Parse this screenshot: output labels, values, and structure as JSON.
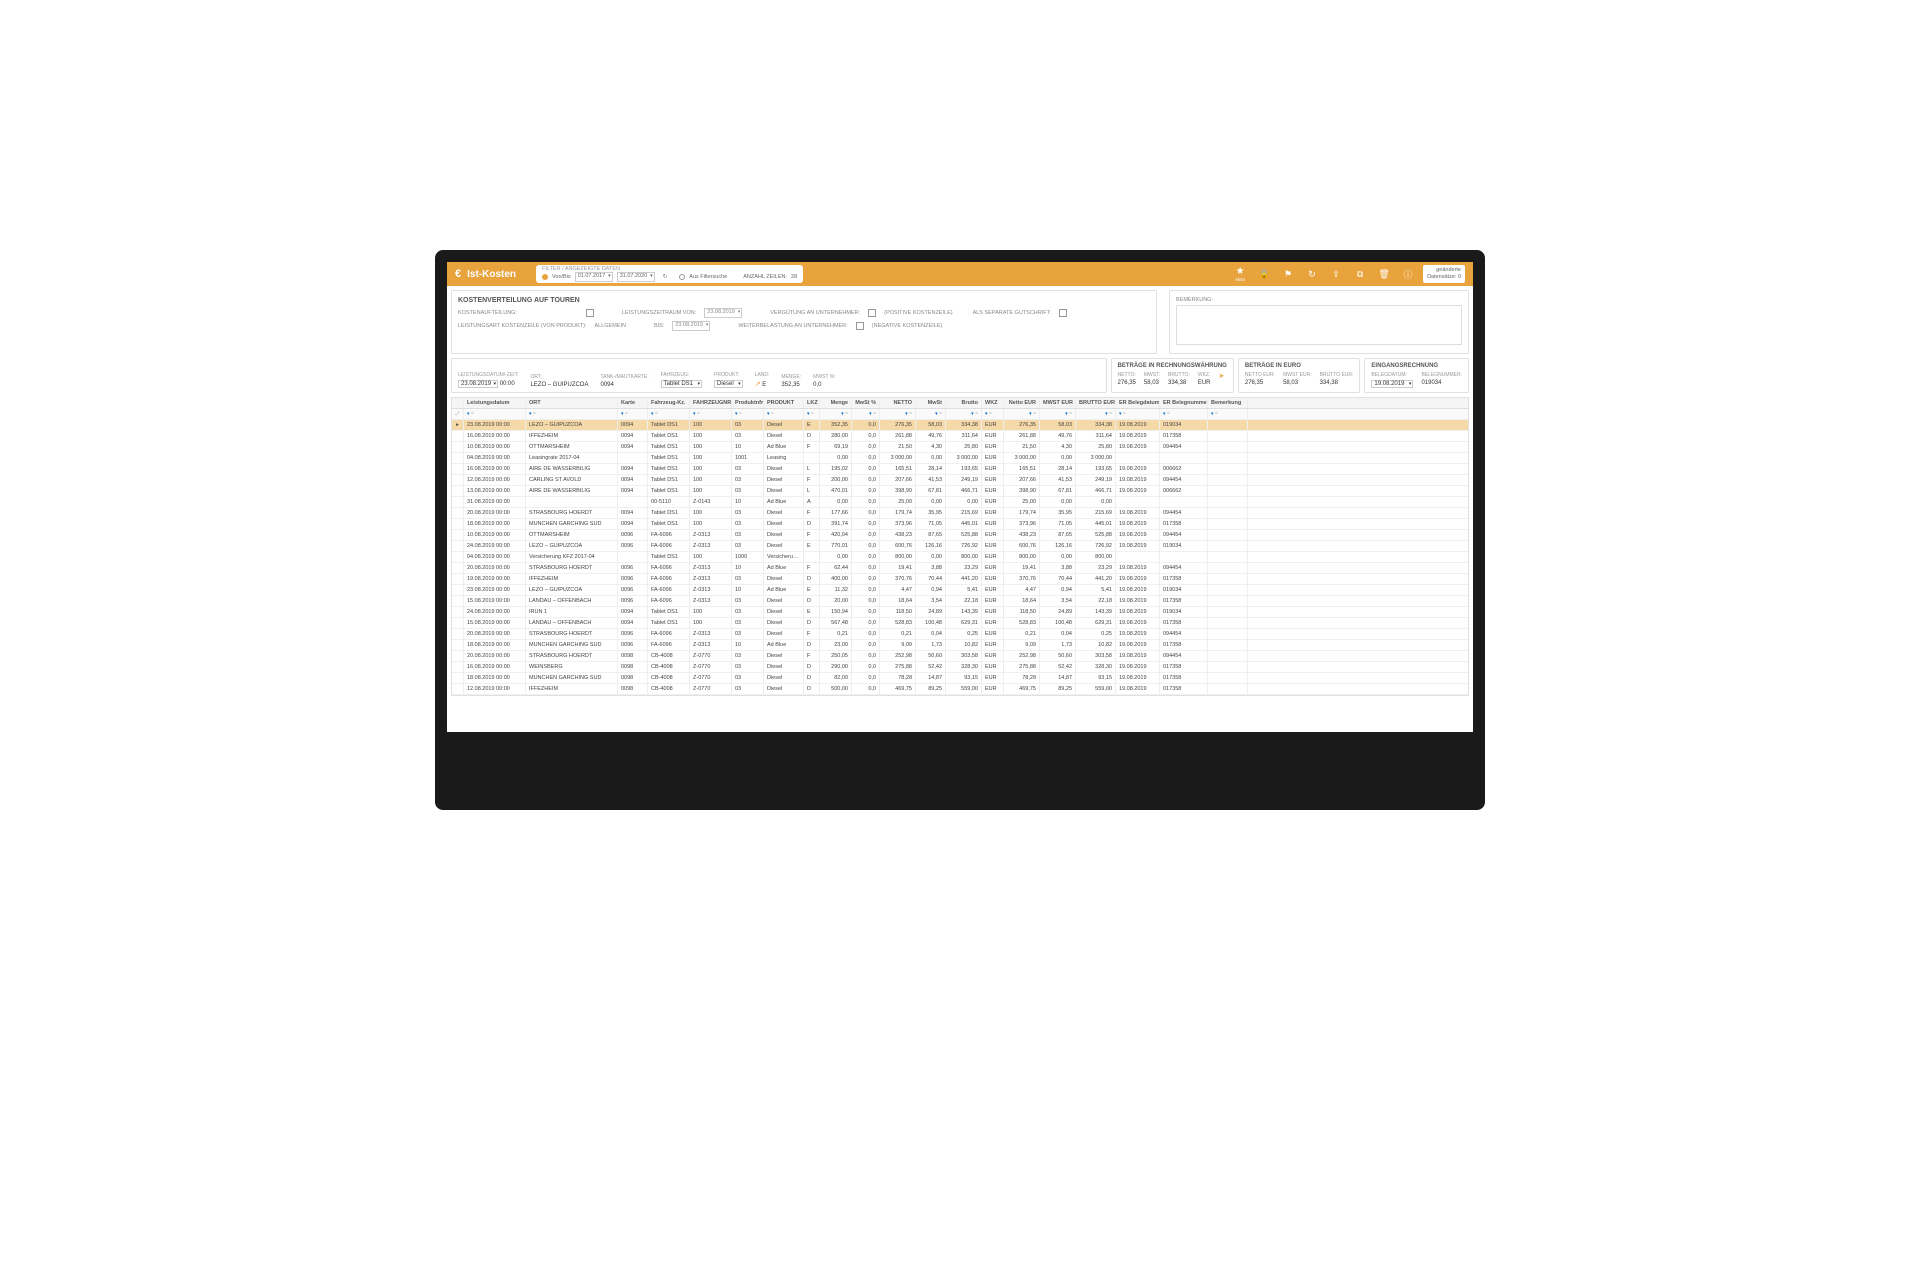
{
  "app": {
    "title": "Ist-Kosten"
  },
  "status": {
    "line1": "geänderte",
    "line2": "Datensätze: 0"
  },
  "toolbar": {
    "star_label": "Aktiv"
  },
  "filter": {
    "header": "FILTER / ANGEZEIGTE DATEN",
    "vonbis": "Von/Bis",
    "from": "01.07.2017",
    "to": "31.07.2020",
    "aus_filter": "Aus Filtersuche",
    "anzahl": "ANZAHL ZEILEN:",
    "anzahl_val": "28"
  },
  "panel": {
    "title": "KOSTENVERTEILUNG AUF TOUREN",
    "row1_l1": "KOSTENAUFTEILUNG:",
    "row1_l2": "LEISTUNGSZEITRAUM VON:",
    "row1_v2": "23.08.2019",
    "row1_l3": "VERGÜTUNG AN UNTERNEHMER:",
    "row1_l4": "(POSITIVE KOSTENZEILE)",
    "row1_l5": "ALS SEPARATE GUTSCHRIFT:",
    "row2_l1": "LEISTUNGSART KOSTENZEILE (VON PRODUKT):",
    "row2_v1": "ALLGEMEIN",
    "row2_l2": "BIS:",
    "row2_v2": "23.08.2019",
    "row2_l3": "WEITERBELASTUNG AN UNTERNEHMER:",
    "row2_l4": "(NEGATIVE KOSTENZEILE)",
    "remark": "BEMERKUNG:"
  },
  "detail": {
    "main": {
      "c1l": "LEISTUNGSDATUM/-ZEIT:",
      "c1v1": "23.08.2019",
      "c1v2": "00:00",
      "c2l": "ORT:",
      "c2v": "LEZO – GUIPUZCOA",
      "c3l": "TANK-/MAUTKARTE:",
      "c3v": "0094",
      "c4l": "FAHRZEUG:",
      "c4v": "Tablet DS1",
      "c5l": "PRODUKT:",
      "c5v": "Diesel",
      "c6l": "LAND:",
      "c6v": "E",
      "c7l": "MENGE:",
      "c7v": "352,35",
      "c8l": "MWST %:",
      "c8v": "0,0"
    },
    "box1": {
      "title": "BETRÄGE IN RECHNUNGSWÄHRUNG",
      "l1": "NETTO:",
      "v1": "276,35",
      "l2": "MWST:",
      "v2": "58,03",
      "l3": "BRUTTO:",
      "v3": "334,38",
      "l4": "WKZ:",
      "v4": "EUR"
    },
    "box2": {
      "title": "BETRÄGE IN EURO",
      "l1": "NETTO EUR:",
      "v1": "276,35",
      "l2": "MWST EUR:",
      "v2": "58,03",
      "l3": "BRUTTO EUR:",
      "v3": "334,38"
    },
    "box3": {
      "title": "EINGANGSRECHNUNG",
      "l1": "BELEGDATUM:",
      "v1": "19.08.2019",
      "l2": "BELEGNUMMER:",
      "v2": "019034"
    }
  },
  "grid": {
    "cols": [
      "",
      "Leistungsdatum",
      "ORT",
      "Karte",
      "Fahrzeug-Kz.",
      "FAHRZEUGNR",
      "Produktnfr",
      "PRODUKT",
      "LKZ",
      "Menge",
      "MwSt %",
      "NETTO",
      "MwSt",
      "Brutto",
      "WKZ",
      "Netto EUR",
      "MWST EUR",
      "BRUTTO EUR",
      "ER Belegdatum",
      "ER Belegnummer",
      "Bemerkung"
    ],
    "rows": [
      {
        "sel": true,
        "d": [
          "▸",
          "23.08.2019 00:00",
          "LEZO – GUIPUZCOA",
          "0094",
          "Tablet DS1",
          "100",
          "03",
          "Diesel",
          "E",
          "352,35",
          "0,0",
          "276,35",
          "58,03",
          "334,38",
          "EUR",
          "276,35",
          "58,03",
          "334,38",
          "19.08.2019",
          "019034",
          ""
        ]
      },
      {
        "d": [
          "",
          "16.08.2019 00:00",
          "IFFEZHEIM",
          "0094",
          "Tablet DS1",
          "100",
          "03",
          "Diesel",
          "D",
          "280,00",
          "0,0",
          "261,88",
          "49,76",
          "311,64",
          "EUR",
          "261,88",
          "49,76",
          "311,64",
          "19.08.2019",
          "017358",
          ""
        ]
      },
      {
        "d": [
          "",
          "10.08.2019 00:00",
          "OTTMARSHEIM",
          "0094",
          "Tablet DS1",
          "100",
          "10",
          "Ad Blue",
          "F",
          "69,19",
          "0,0",
          "21,50",
          "4,30",
          "25,80",
          "EUR",
          "21,50",
          "4,30",
          "25,80",
          "19.08.2019",
          "094454",
          ""
        ]
      },
      {
        "d": [
          "",
          "04.08.2019 00:00",
          "Leasingrate 2017-04",
          "",
          "Tablet DS1",
          "100",
          "1001",
          "Leasing",
          "",
          "0,00",
          "0,0",
          "3 000,00",
          "0,00",
          "3 000,00",
          "EUR",
          "3 000,00",
          "0,00",
          "3 000,00",
          "",
          "",
          ""
        ]
      },
      {
        "d": [
          "",
          "16.08.2019 00:00",
          "AIRE DE WASSERBILIG",
          "0094",
          "Tablet DS1",
          "100",
          "03",
          "Diesel",
          "L",
          "195,02",
          "0,0",
          "165,51",
          "28,14",
          "193,65",
          "EUR",
          "165,51",
          "28,14",
          "193,65",
          "19.08.2019",
          "006662",
          ""
        ]
      },
      {
        "d": [
          "",
          "12.08.2019 00:00",
          "CARLING ST AVOLD",
          "0094",
          "Tablet DS1",
          "100",
          "03",
          "Diesel",
          "F",
          "200,00",
          "0,0",
          "207,66",
          "41,53",
          "249,19",
          "EUR",
          "207,66",
          "41,53",
          "249,19",
          "19.08.2019",
          "094454",
          ""
        ]
      },
      {
        "d": [
          "",
          "13.08.2019 00:00",
          "AIRE DE WASSERBILIG",
          "0094",
          "Tablet DS1",
          "100",
          "03",
          "Diesel",
          "L",
          "470,01",
          "0,0",
          "398,90",
          "67,81",
          "466,71",
          "EUR",
          "398,90",
          "67,81",
          "466,71",
          "19.08.2019",
          "006662",
          ""
        ]
      },
      {
        "d": [
          "",
          "31.08.2019 00:00",
          "",
          "",
          "00-5110",
          "Z-0143",
          "10",
          "Ad Blue",
          "A",
          "0,00",
          "0,0",
          "25,00",
          "0,00",
          "0,00",
          "EUR",
          "25,00",
          "0,00",
          "0,00",
          "",
          "",
          ""
        ]
      },
      {
        "d": [
          "",
          "20.08.2019 00:00",
          "STRASBOURG HOERDT",
          "0094",
          "Tablet DS1",
          "100",
          "03",
          "Diesel",
          "F",
          "177,66",
          "0,0",
          "179,74",
          "35,95",
          "215,69",
          "EUR",
          "179,74",
          "35,95",
          "215,69",
          "19.08.2019",
          "094454",
          ""
        ]
      },
      {
        "d": [
          "",
          "18.08.2019 00:00",
          "MUNCHEN GARCHING SUD",
          "0094",
          "Tablet DS1",
          "100",
          "03",
          "Diesel",
          "D",
          "391,74",
          "0,0",
          "373,96",
          "71,05",
          "445,01",
          "EUR",
          "373,96",
          "71,05",
          "445,01",
          "19.08.2019",
          "017358",
          ""
        ]
      },
      {
        "d": [
          "",
          "10.08.2019 00:00",
          "OTTMARSHEIM",
          "0096",
          "FA-6096",
          "Z-0313",
          "03",
          "Diesel",
          "F",
          "420,04",
          "0,0",
          "438,23",
          "87,65",
          "525,88",
          "EUR",
          "438,23",
          "87,65",
          "525,88",
          "19.08.2019",
          "094454",
          ""
        ]
      },
      {
        "d": [
          "",
          "24.08.2019 00:00",
          "LEZO – GUIPUZCOA",
          "0096",
          "FA-6096",
          "Z-0313",
          "03",
          "Diesel",
          "E",
          "770,01",
          "0,0",
          "600,76",
          "126,16",
          "726,92",
          "EUR",
          "600,76",
          "126,16",
          "726,92",
          "19.08.2019",
          "019034",
          ""
        ]
      },
      {
        "d": [
          "",
          "04.08.2019 00:00",
          "Versicherung KFZ 2017-04",
          "",
          "Tablet DS1",
          "100",
          "1000",
          "Versicheru…",
          "",
          "0,00",
          "0,0",
          "800,00",
          "0,00",
          "800,00",
          "EUR",
          "800,00",
          "0,00",
          "800,00",
          "",
          "",
          ""
        ]
      },
      {
        "d": [
          "",
          "20.08.2019 00:00",
          "STRASBOURG HOERDT",
          "0096",
          "FA-6096",
          "Z-0313",
          "10",
          "Ad Blue",
          "F",
          "62,44",
          "0,0",
          "19,41",
          "3,88",
          "23,29",
          "EUR",
          "19,41",
          "3,88",
          "23,29",
          "19.08.2019",
          "094454",
          ""
        ]
      },
      {
        "d": [
          "",
          "19.08.2019 00:00",
          "IFFEZHEIM",
          "0096",
          "FA-6096",
          "Z-0313",
          "03",
          "Diesel",
          "D",
          "400,00",
          "0,0",
          "370,76",
          "70,44",
          "441,20",
          "EUR",
          "370,76",
          "70,44",
          "441,20",
          "19.08.2019",
          "017358",
          ""
        ]
      },
      {
        "d": [
          "",
          "23.08.2019 00:00",
          "LEZO – GUIPUZCOA",
          "0096",
          "FA-6096",
          "Z-0313",
          "10",
          "Ad Blue",
          "E",
          "11,32",
          "0,0",
          "4,47",
          "0,94",
          "5,41",
          "EUR",
          "4,47",
          "0,94",
          "5,41",
          "19.08.2019",
          "019034",
          ""
        ]
      },
      {
        "d": [
          "",
          "15.08.2019 00:00",
          "LANDAU – OFFENBACH",
          "0096",
          "FA-6096",
          "Z-0313",
          "03",
          "Diesel",
          "D",
          "20,00",
          "0,0",
          "18,64",
          "3,54",
          "22,18",
          "EUR",
          "18,64",
          "3,54",
          "22,18",
          "19.08.2019",
          "017358",
          ""
        ]
      },
      {
        "d": [
          "",
          "24.08.2019 00:00",
          "IRUN 1",
          "0094",
          "Tablet DS1",
          "100",
          "03",
          "Diesel",
          "E",
          "150,94",
          "0,0",
          "118,50",
          "24,89",
          "143,39",
          "EUR",
          "118,50",
          "24,89",
          "143,39",
          "19.08.2019",
          "019034",
          ""
        ]
      },
      {
        "d": [
          "",
          "15.08.2019 00:00",
          "LANDAU – OFFENBACH",
          "0094",
          "Tablet DS1",
          "100",
          "03",
          "Diesel",
          "D",
          "567,48",
          "0,0",
          "528,83",
          "100,48",
          "629,31",
          "EUR",
          "528,83",
          "100,48",
          "629,31",
          "19.08.2019",
          "017358",
          ""
        ]
      },
      {
        "d": [
          "",
          "20.08.2019 00:00",
          "STRASBOURG HOERDT",
          "0096",
          "FA-6096",
          "Z-0313",
          "03",
          "Diesel",
          "F",
          "0,21",
          "0,0",
          "0,21",
          "0,04",
          "0,25",
          "EUR",
          "0,21",
          "0,04",
          "0,25",
          "19.08.2019",
          "094454",
          ""
        ]
      },
      {
        "d": [
          "",
          "18.08.2019 00:00",
          "MUNCHEN GARCHING SUD",
          "0096",
          "FA-6096",
          "Z-0313",
          "10",
          "Ad Blue",
          "D",
          "23,00",
          "0,0",
          "9,09",
          "1,73",
          "10,82",
          "EUR",
          "9,09",
          "1,73",
          "10,82",
          "19.08.2019",
          "017358",
          ""
        ]
      },
      {
        "d": [
          "",
          "20.08.2019 00:00",
          "STRASBOURG HOERDT",
          "0098",
          "CB-4008",
          "Z-0770",
          "03",
          "Diesel",
          "F",
          "250,05",
          "0,0",
          "252,98",
          "50,60",
          "303,58",
          "EUR",
          "252,98",
          "50,60",
          "303,58",
          "19.08.2019",
          "094454",
          ""
        ]
      },
      {
        "d": [
          "",
          "16.08.2019 00:00",
          "WEINSBERG",
          "0098",
          "CB-4008",
          "Z-0770",
          "03",
          "Diesel",
          "D",
          "290,00",
          "0,0",
          "275,88",
          "52,42",
          "328,30",
          "EUR",
          "275,88",
          "52,42",
          "328,30",
          "19.08.2019",
          "017358",
          ""
        ]
      },
      {
        "d": [
          "",
          "18.08.2019 00:00",
          "MUNCHEN GARCHING SUD",
          "0098",
          "CB-4008",
          "Z-0770",
          "03",
          "Diesel",
          "D",
          "82,00",
          "0,0",
          "78,28",
          "14,87",
          "93,15",
          "EUR",
          "78,28",
          "14,87",
          "93,15",
          "19.08.2019",
          "017358",
          ""
        ]
      },
      {
        "d": [
          "",
          "12.08.2019 00:00",
          "IFFEZHEIM",
          "0098",
          "CB-4008",
          "Z-0770",
          "03",
          "Diesel",
          "D",
          "500,00",
          "0,0",
          "469,75",
          "89,25",
          "559,00",
          "EUR",
          "469,75",
          "89,25",
          "559,00",
          "19.08.2019",
          "017358",
          ""
        ]
      }
    ]
  }
}
